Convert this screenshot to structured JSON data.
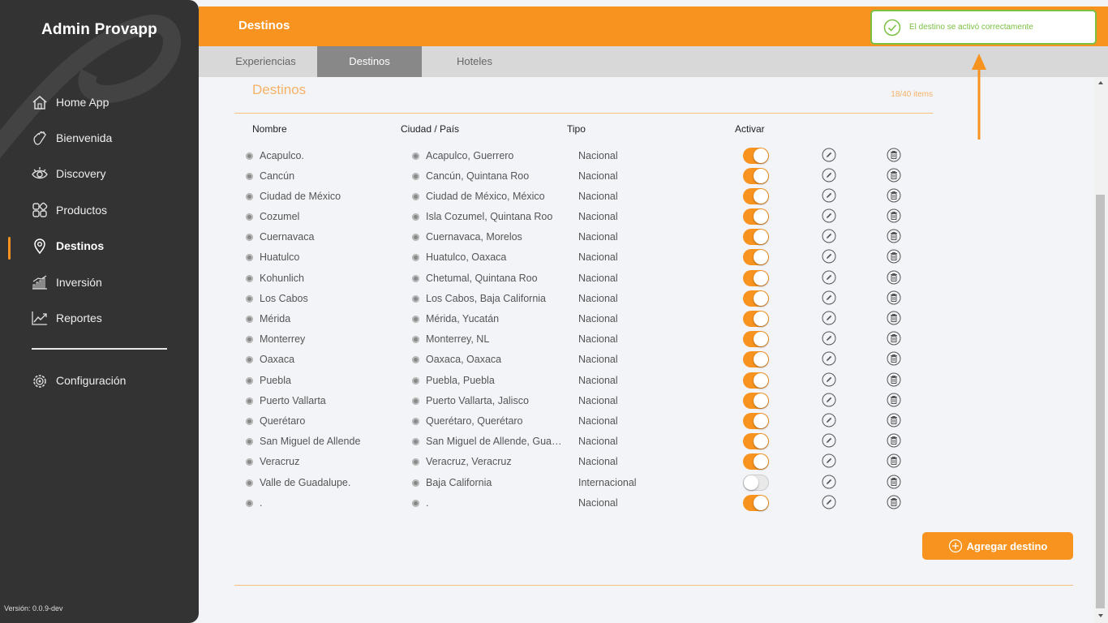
{
  "sidebar": {
    "brand": "Admin Provapp",
    "items": [
      {
        "label": "Home App",
        "icon": "home-icon"
      },
      {
        "label": "Bienvenida",
        "icon": "wave-hand-icon"
      },
      {
        "label": "Discovery",
        "icon": "eye-icon"
      },
      {
        "label": "Productos",
        "icon": "grid-icon"
      },
      {
        "label": "Destinos",
        "icon": "location-pin-icon",
        "active": true
      },
      {
        "label": "Inversión",
        "icon": "bar-chart-icon"
      },
      {
        "label": "Reportes",
        "icon": "line-chart-icon"
      }
    ],
    "settings": {
      "label": "Configuración",
      "icon": "gear-icon"
    },
    "version": "Versión: 0.0.9-dev"
  },
  "header": {
    "title": "Destinos"
  },
  "tabs": [
    {
      "label": "Experiencias"
    },
    {
      "label": "Destinos",
      "active": true
    },
    {
      "label": "Hoteles"
    }
  ],
  "toast": {
    "message": "El destino se activó correctamente",
    "color": "#7bc043"
  },
  "main": {
    "section_title": "Destinos",
    "count": "18/40 items",
    "columns": {
      "nombre": "Nombre",
      "ciudad": "Ciudad / País",
      "tipo": "Tipo",
      "activar": "Activar"
    },
    "rows": [
      {
        "nombre": "Acapulco.",
        "ciudad": "Acapulco, Guerrero",
        "tipo": "Nacional",
        "activo": true
      },
      {
        "nombre": "Cancún",
        "ciudad": "Cancún, Quintana Roo",
        "tipo": "Nacional",
        "activo": true
      },
      {
        "nombre": "Ciudad de México",
        "ciudad": "Ciudad de México, México",
        "tipo": "Nacional",
        "activo": true
      },
      {
        "nombre": "Cozumel",
        "ciudad": "Isla Cozumel, Quintana Roo",
        "tipo": "Nacional",
        "activo": true
      },
      {
        "nombre": "Cuernavaca",
        "ciudad": "Cuernavaca, Morelos",
        "tipo": "Nacional",
        "activo": true
      },
      {
        "nombre": "Huatulco",
        "ciudad": "Huatulco, Oaxaca",
        "tipo": "Nacional",
        "activo": true
      },
      {
        "nombre": "Kohunlich",
        "ciudad": "Chetumal, Quintana Roo",
        "tipo": "Nacional",
        "activo": true
      },
      {
        "nombre": "Los Cabos",
        "ciudad": "Los Cabos, Baja California",
        "tipo": "Nacional",
        "activo": true
      },
      {
        "nombre": "Mérida",
        "ciudad": "Mérida, Yucatán",
        "tipo": "Nacional",
        "activo": true
      },
      {
        "nombre": "Monterrey",
        "ciudad": "Monterrey, NL",
        "tipo": "Nacional",
        "activo": true
      },
      {
        "nombre": "Oaxaca",
        "ciudad": "Oaxaca, Oaxaca",
        "tipo": "Nacional",
        "activo": true
      },
      {
        "nombre": "Puebla",
        "ciudad": "Puebla, Puebla",
        "tipo": "Nacional",
        "activo": true
      },
      {
        "nombre": "Puerto Vallarta",
        "ciudad": "Puerto Vallarta, Jalisco",
        "tipo": "Nacional",
        "activo": true
      },
      {
        "nombre": "Querétaro",
        "ciudad": "Querétaro, Querétaro",
        "tipo": "Nacional",
        "activo": true
      },
      {
        "nombre": "San Miguel de Allende",
        "ciudad": "San Miguel de Allende, Gua…",
        "tipo": "Nacional",
        "activo": true
      },
      {
        "nombre": "Veracruz",
        "ciudad": "Veracruz, Veracruz",
        "tipo": "Nacional",
        "activo": true
      },
      {
        "nombre": "Valle de Guadalupe.",
        "ciudad": "Baja California",
        "tipo": "Internacional",
        "activo": false
      },
      {
        "nombre": ".",
        "ciudad": ".",
        "tipo": "Nacional",
        "activo": true
      }
    ],
    "add_button": "Agregar destino"
  },
  "colors": {
    "accent": "#f7931e",
    "sidebar_bg": "#333333",
    "success": "#7bc043"
  }
}
